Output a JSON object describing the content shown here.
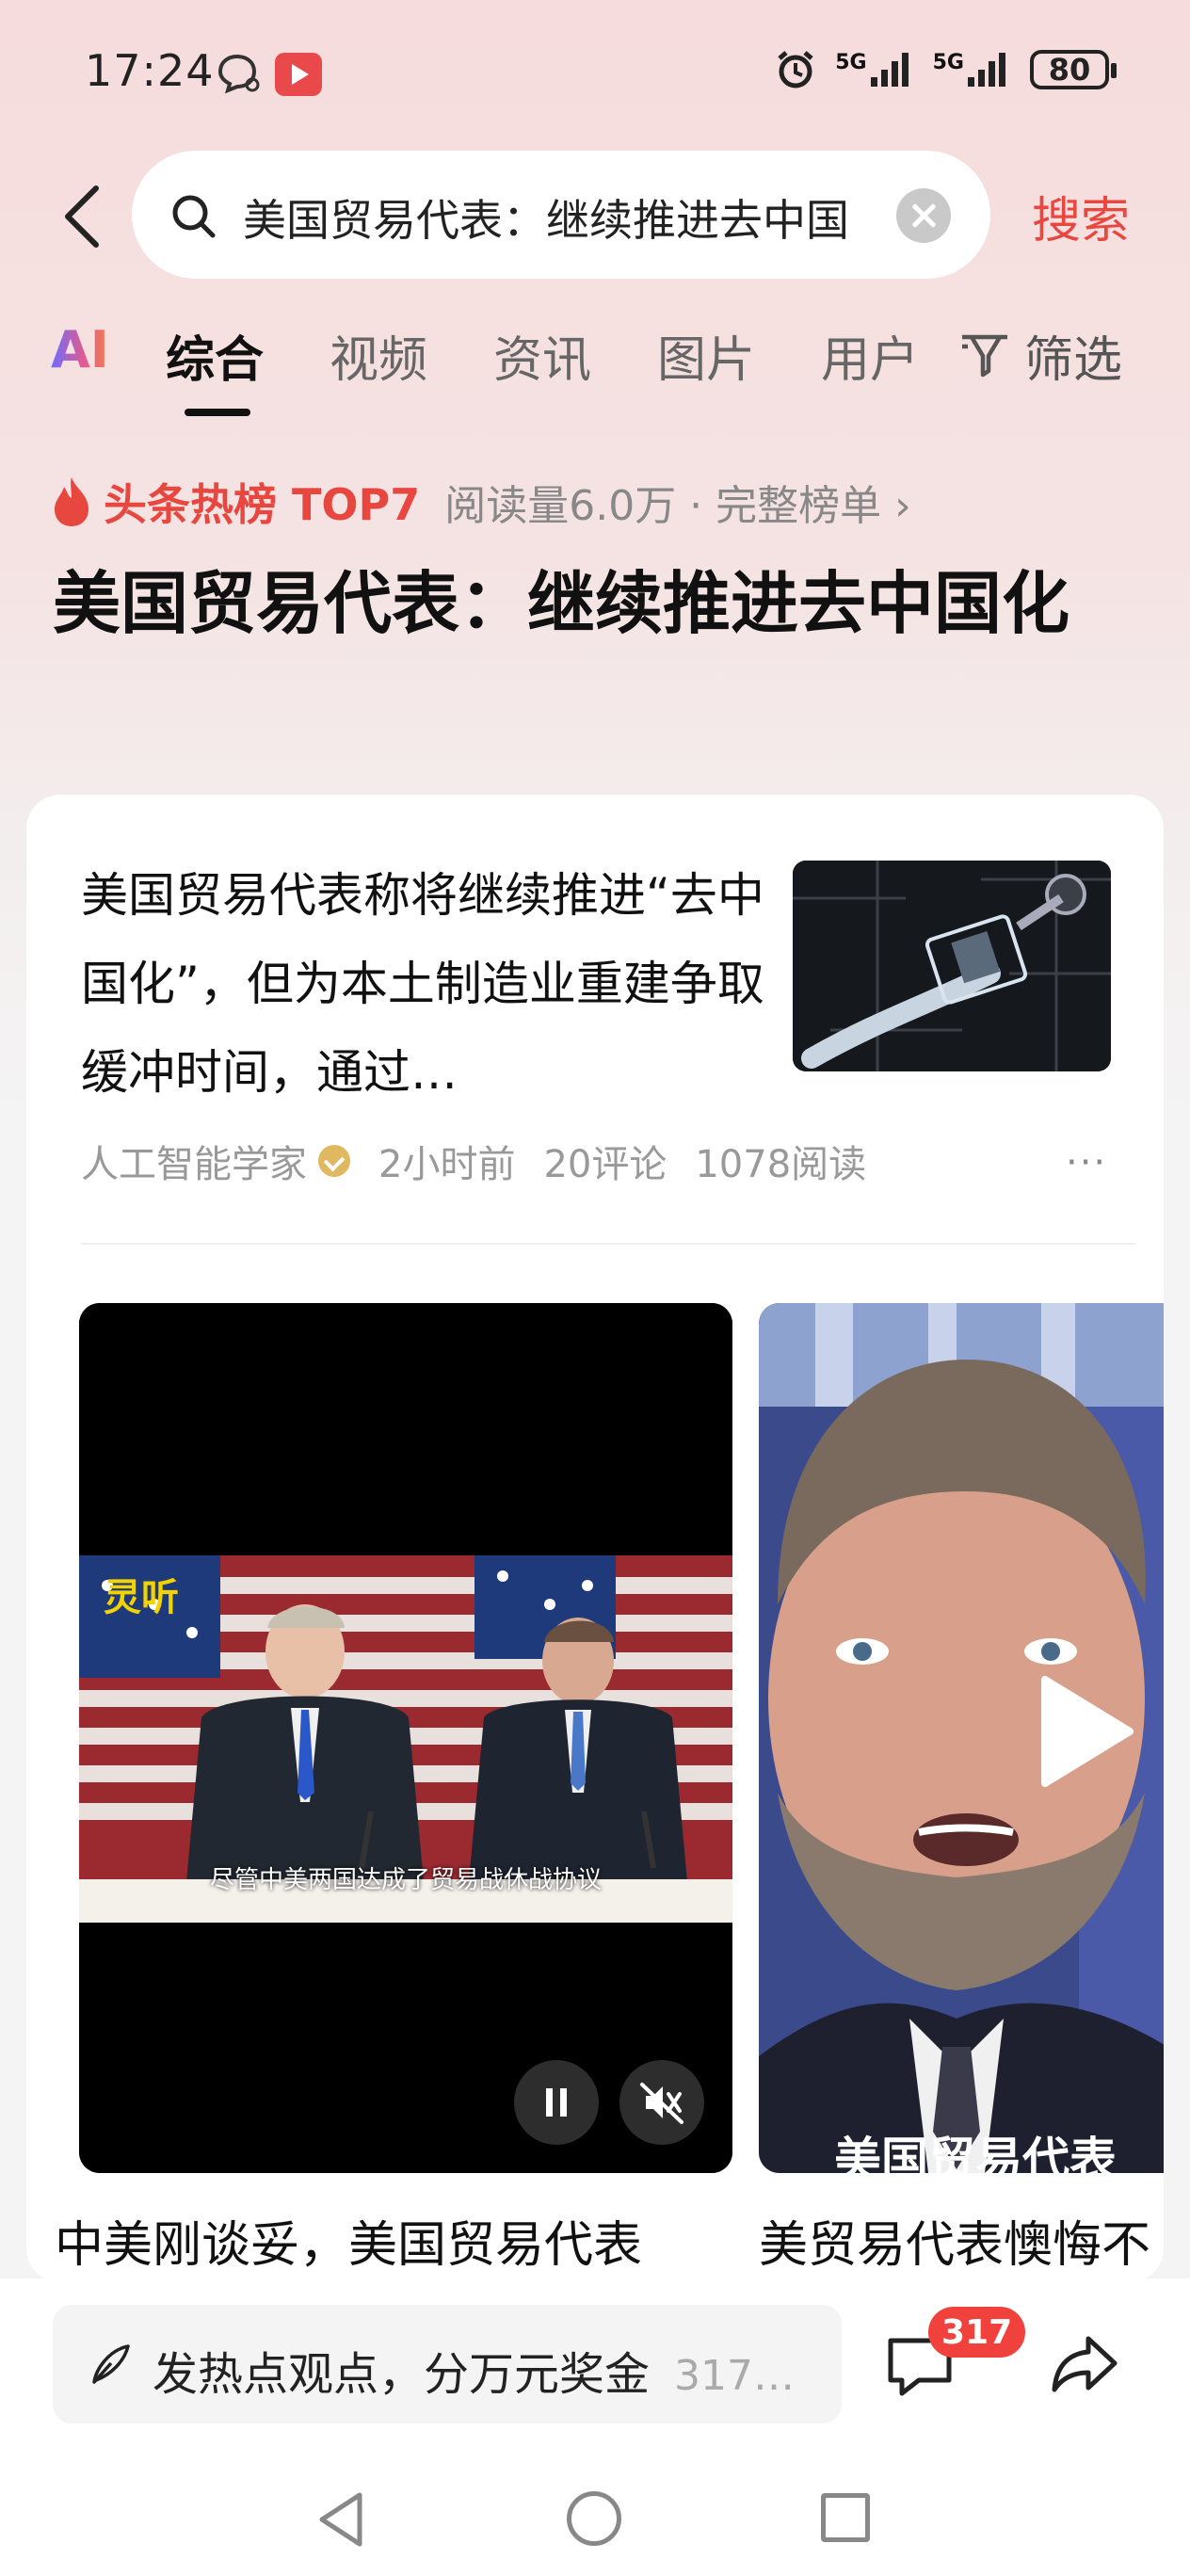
{
  "status_bar": {
    "time": "17:24",
    "network1": "5G",
    "network2": "5G",
    "battery": "80"
  },
  "search": {
    "query": "美国贸易代表：继续推进去中国化",
    "search_label": "搜索"
  },
  "tabs": [
    {
      "label": "AI"
    },
    {
      "label": "综合"
    },
    {
      "label": "视频"
    },
    {
      "label": "资讯"
    },
    {
      "label": "图片"
    },
    {
      "label": "用户"
    }
  ],
  "filter_label": "筛选",
  "hot": {
    "label": "头条热榜 TOP7",
    "meta": "阅读量6.0万 · 完整榜单 ›"
  },
  "topic_title": "美国贸易代表：继续推进去中国化",
  "article": {
    "text": "美国贸易代表称将继续推进“去中国化”，但为本土制造业重建争取缓冲时间，通过…",
    "author": "人工智能学家",
    "time": "2小时前",
    "comments": "20评论",
    "reads": "1078阅读",
    "more": "···"
  },
  "videos": [
    {
      "title": "中美刚谈妥，美国贸易代表",
      "watermark": "灵听",
      "subtitle": "尽管中美两国达成了贸易战休战协议"
    },
    {
      "title": "美贸易代表懊悔不",
      "caption": "美国贸易代表"
    }
  ],
  "bottom": {
    "comment_placeholder": "发热点观点，分万元奖金",
    "comment_count_inline": "317…",
    "badge": "317"
  },
  "colors": {
    "accent": "#e8473f",
    "badge": "#f0413d"
  }
}
